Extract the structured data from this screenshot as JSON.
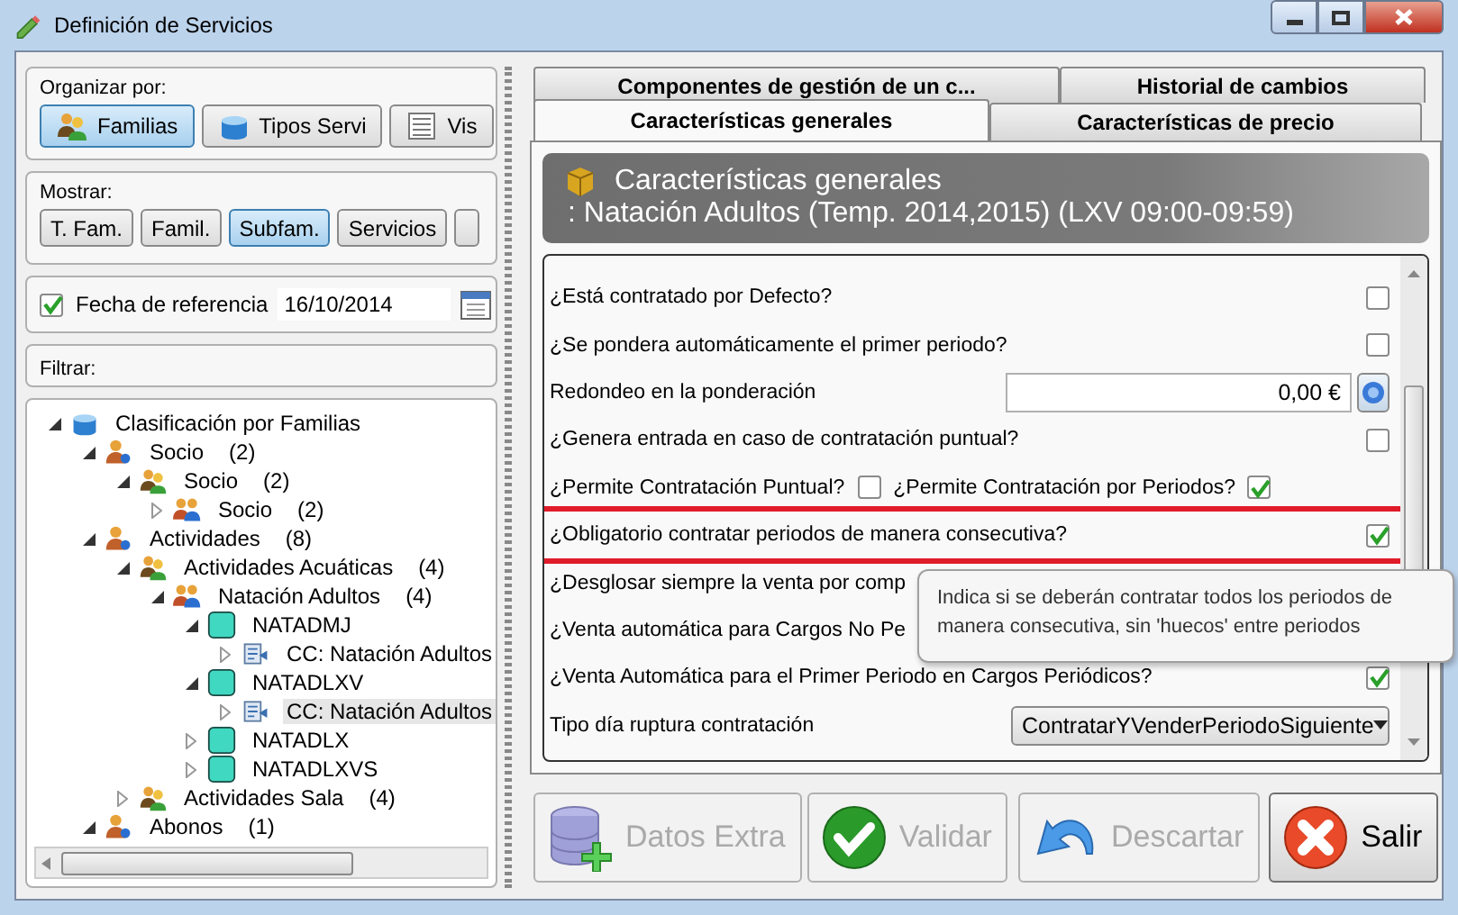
{
  "window": {
    "title": "Definición de Servicios"
  },
  "organize": {
    "label": "Organizar por:",
    "buttons": [
      {
        "label": "Familias",
        "kind": "people",
        "selected": true
      },
      {
        "label": "Tipos Servi",
        "kind": "box",
        "selected": false
      },
      {
        "label": "Vis",
        "kind": "list",
        "selected": false
      }
    ]
  },
  "show": {
    "label": "Mostrar:",
    "buttons": [
      {
        "label": "T. Fam.",
        "selected": false
      },
      {
        "label": "Famil.",
        "selected": false
      },
      {
        "label": "Subfam.",
        "selected": true
      },
      {
        "label": "Servicios",
        "selected": false
      },
      {
        "selected": false
      }
    ]
  },
  "reference_date": {
    "label": "Fecha de referencia",
    "checked": true,
    "value": "16/10/2014"
  },
  "filter": {
    "label": "Filtrar:"
  },
  "tree": {
    "items": [
      {
        "label": "Clasificación por Familias",
        "kind": "box",
        "expanded": true,
        "selected": false,
        "children": [
          {
            "label": "Socio",
            "count": "(2)",
            "kind": "person",
            "expanded": true,
            "selected": false,
            "children": [
              {
                "label": "Socio",
                "count": "(2)",
                "kind": "group",
                "expanded": true,
                "selected": false,
                "children": [
                  {
                    "label": "Socio",
                    "count": "(2)",
                    "kind": "family",
                    "expanded": false,
                    "selected": false
                  }
                ]
              }
            ]
          },
          {
            "label": "Actividades",
            "count": "(8)",
            "kind": "person",
            "expanded": true,
            "selected": false,
            "children": [
              {
                "label": "Actividades Acuáticas",
                "count": "(4)",
                "kind": "group",
                "expanded": true,
                "selected": false,
                "children": [
                  {
                    "label": "Natación Adultos",
                    "count": "(4)",
                    "kind": "family",
                    "expanded": true,
                    "selected": false,
                    "children": [
                      {
                        "label": "NATADMJ",
                        "kind": "service",
                        "expanded": true,
                        "selected": false,
                        "children": [
                          {
                            "label": "CC: Natación Adultos",
                            "kind": "component",
                            "expanded": false,
                            "selected": false
                          }
                        ]
                      },
                      {
                        "label": "NATADLXV",
                        "kind": "service",
                        "expanded": true,
                        "selected": false,
                        "children": [
                          {
                            "label": "CC: Natación Adultos",
                            "kind": "component",
                            "expanded": false,
                            "selected": true
                          }
                        ]
                      },
                      {
                        "label": "NATADLX",
                        "kind": "service",
                        "expanded": false,
                        "selected": false
                      },
                      {
                        "label": "NATADLXVS",
                        "kind": "service",
                        "expanded": false,
                        "selected": false
                      }
                    ]
                  }
                ]
              },
              {
                "label": "Actividades Sala",
                "count": "(4)",
                "kind": "group",
                "expanded": false,
                "selected": false
              }
            ]
          },
          {
            "label": "Abonos",
            "count": "(1)",
            "kind": "person",
            "expanded": true,
            "selected": false
          }
        ]
      }
    ]
  },
  "tabs": [
    {
      "label": "Componentes de gestión de un c...",
      "selected": false
    },
    {
      "label": "Historial de cambios",
      "selected": false
    },
    {
      "label": "Características generales",
      "selected": true
    },
    {
      "label": "Características de precio",
      "selected": false
    }
  ],
  "header": {
    "title": "Características generales",
    "subtitle": ": Natación Adultos (Temp. 2014,2015) (LXV 09:00-09:59)"
  },
  "properties": {
    "rows": [
      {
        "kind": "checkbox",
        "label": "¿Está contratado por Defecto?",
        "checked": false,
        "highlighted": false
      },
      {
        "kind": "checkbox",
        "label": "¿Se pondera automáticamente el primer periodo?",
        "checked": false,
        "highlighted": false
      },
      {
        "kind": "money",
        "label": "Redondeo en la ponderación",
        "value": "0,00 €",
        "highlighted": false
      },
      {
        "kind": "checkbox",
        "label": "¿Genera entrada en caso de contratación puntual?",
        "checked": false,
        "highlighted": false
      },
      {
        "kind": "pair",
        "highlighted": false,
        "items": [
          {
            "label": "¿Permite Contratación Puntual?",
            "checked": false
          },
          {
            "label": "¿Permite Contratación por Periodos?",
            "checked": true
          }
        ]
      },
      {
        "kind": "checkbox",
        "label": "¿Obligatorio contratar periodos de manera consecutiva?",
        "checked": true,
        "highlighted": true
      },
      {
        "kind": "text",
        "label": "¿Desglosar siempre la venta por comp",
        "highlighted": false
      },
      {
        "kind": "text",
        "label": "¿Venta automática para Cargos No Pe",
        "highlighted": false
      },
      {
        "kind": "checkbox",
        "label": "¿Venta Automática para el Primer Periodo en Cargos Periódicos?",
        "checked": true,
        "highlighted": false
      },
      {
        "kind": "select",
        "label": "Tipo día ruptura contratación",
        "value": "ContratarYVenderPeriodoSiguiente",
        "highlighted": false
      }
    ]
  },
  "tooltip": {
    "text": "Indica si se deberán contratar todos los periodos de manera consecutiva, sin 'huecos' entre periodos"
  },
  "actions": [
    {
      "label": "Datos Extra",
      "kind": "database",
      "disabled": true
    },
    {
      "label": "Validar",
      "kind": "check",
      "disabled": true
    },
    {
      "label": "Descartar",
      "kind": "undo",
      "disabled": true
    },
    {
      "label": "Salir",
      "kind": "exit",
      "disabled": false
    }
  ]
}
